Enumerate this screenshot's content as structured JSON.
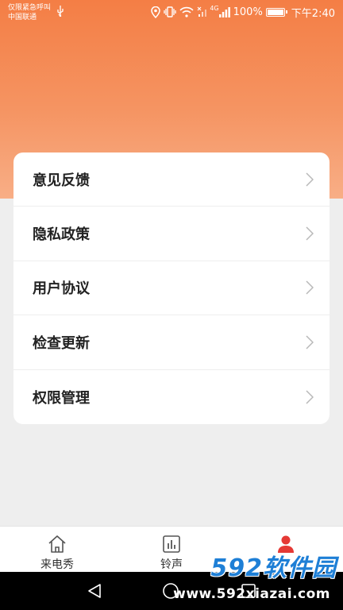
{
  "status_bar": {
    "carrier_line1": "仅限紧急呼叫",
    "carrier_line2": "中国联通",
    "battery": "100%",
    "time": "下午2:40",
    "net_label": "4G"
  },
  "menu": {
    "items": [
      {
        "label": "意见反馈"
      },
      {
        "label": "隐私政策"
      },
      {
        "label": "用户协议"
      },
      {
        "label": "检查更新"
      },
      {
        "label": "权限管理"
      }
    ]
  },
  "tabbar": {
    "tabs": [
      {
        "label": "来电秀",
        "icon": "home-icon"
      },
      {
        "label": "铃声",
        "icon": "ringtone-chart-icon"
      },
      {
        "label": "",
        "icon": "profile-icon",
        "active": true
      }
    ],
    "active_color": "#e53935"
  },
  "watermark": {
    "brand": "592软件园",
    "url": "www.592xiazai.com"
  },
  "colors": {
    "header_gradient_top": "#f47e45",
    "header_gradient_bottom": "#f8ae86",
    "background": "#eeeeee"
  }
}
